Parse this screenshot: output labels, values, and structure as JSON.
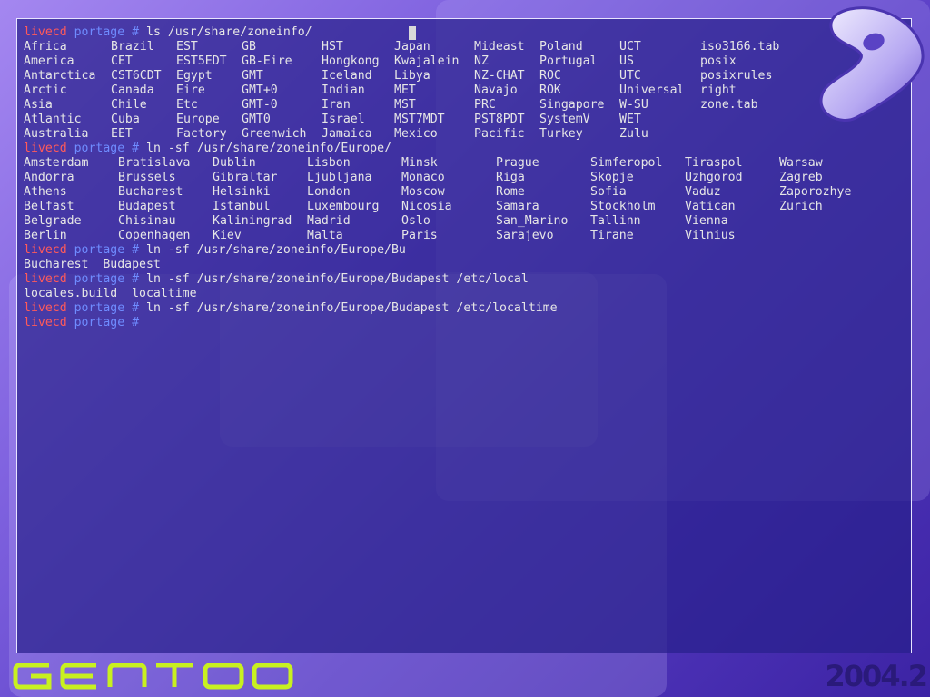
{
  "prompt": {
    "host": "livecd",
    "dir": "portage",
    "symbol": "#"
  },
  "commands": [
    " ls /usr/share/zoneinfo/",
    " ln -sf /usr/share/zoneinfo/Europe/",
    " ln -sf /usr/share/zoneinfo/Europe/Bu",
    " ln -sf /usr/share/zoneinfo/Europe/Budapest /etc/local",
    " ln -sf /usr/share/zoneinfo/Europe/Budapest /etc/localtime"
  ],
  "zoneinfo_listing": [
    [
      "Africa",
      "Brazil",
      "EST",
      "GB",
      "HST",
      "Japan",
      "Mideast",
      "Poland",
      "UCT",
      "iso3166.tab"
    ],
    [
      "America",
      "CET",
      "EST5EDT",
      "GB-Eire",
      "Hongkong",
      "Kwajalein",
      "NZ",
      "Portugal",
      "US",
      "posix"
    ],
    [
      "Antarctica",
      "CST6CDT",
      "Egypt",
      "GMT",
      "Iceland",
      "Libya",
      "NZ-CHAT",
      "ROC",
      "UTC",
      "posixrules"
    ],
    [
      "Arctic",
      "Canada",
      "Eire",
      "GMT+0",
      "Indian",
      "MET",
      "Navajo",
      "ROK",
      "Universal",
      "right"
    ],
    [
      "Asia",
      "Chile",
      "Etc",
      "GMT-0",
      "Iran",
      "MST",
      "PRC",
      "Singapore",
      "W-SU",
      "zone.tab"
    ],
    [
      "Atlantic",
      "Cuba",
      "Europe",
      "GMT0",
      "Israel",
      "MST7MDT",
      "PST8PDT",
      "SystemV",
      "WET",
      ""
    ],
    [
      "Australia",
      "EET",
      "Factory",
      "Greenwich",
      "Jamaica",
      "Mexico",
      "Pacific",
      "Turkey",
      "Zulu",
      ""
    ]
  ],
  "europe_listing": [
    [
      "Amsterdam",
      "Bratislava",
      "Dublin",
      "Lisbon",
      "Minsk",
      "Prague",
      "Simferopol",
      "Tiraspol",
      "Warsaw"
    ],
    [
      "Andorra",
      "Brussels",
      "Gibraltar",
      "Ljubljana",
      "Monaco",
      "Riga",
      "Skopje",
      "Uzhgorod",
      "Zagreb"
    ],
    [
      "Athens",
      "Bucharest",
      "Helsinki",
      "London",
      "Moscow",
      "Rome",
      "Sofia",
      "Vaduz",
      "Zaporozhye"
    ],
    [
      "Belfast",
      "Budapest",
      "Istanbul",
      "Luxembourg",
      "Nicosia",
      "Samara",
      "Stockholm",
      "Vatican",
      "Zurich"
    ],
    [
      "Belgrade",
      "Chisinau",
      "Kaliningrad",
      "Madrid",
      "Oslo",
      "San_Marino",
      "Tallinn",
      "Vienna",
      ""
    ],
    [
      "Berlin",
      "Copenhagen",
      "Kiev",
      "Malta",
      "Paris",
      "Sarajevo",
      "Tirane",
      "Vilnius",
      ""
    ]
  ],
  "bu_completion": "Bucharest  Budapest",
  "local_completion": "locales.build  localtime",
  "branding": {
    "logo_text": "gentoo",
    "version": "2004.2"
  },
  "colors": {
    "host": "#ff5a5a",
    "dir": "#6f8cff",
    "text": "#e6e6e6",
    "logo_green": "#c8f020"
  }
}
